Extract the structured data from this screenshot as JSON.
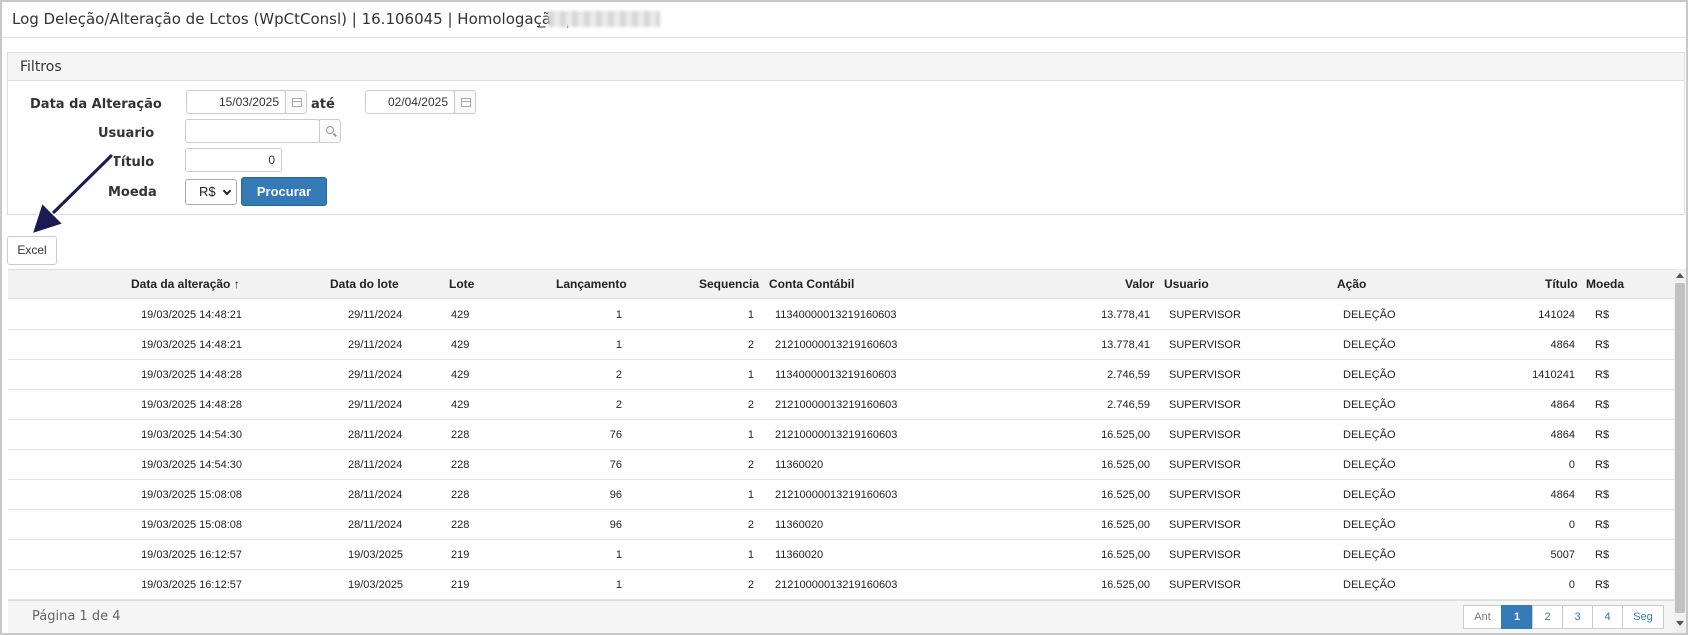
{
  "window": {
    "title": "Log Deleção/Alteração de Lctos (WpCtConsl) | 16.106045 | Homologação | S",
    "redacted_suffix": "_"
  },
  "filters": {
    "panel_title": "Filtros",
    "date_label": "Data da Alteração",
    "date_from": "15/03/2025",
    "date_connector": "até",
    "date_to": "02/04/2025",
    "user_label": "Usuario",
    "user_value": "",
    "titulo_label": "Título",
    "titulo_value": "0",
    "moeda_label": "Moeda",
    "moeda_value": "R$",
    "search_button": "Procurar"
  },
  "excel_button": "Excel",
  "table": {
    "columns": {
      "data_alteracao": "Data da alteração",
      "sort_indicator": "↑",
      "data_lote": "Data do lote",
      "lote": "Lote",
      "lancamento": "Lançamento",
      "sequencia": "Sequencia",
      "conta": "Conta Contábil",
      "valor": "Valor",
      "usuario": "Usuario",
      "acao": "Ação",
      "titulo": "Título",
      "moeda": "Moeda"
    },
    "rows": [
      {
        "data_alteracao": "19/03/2025 14:48:21",
        "data_lote": "29/11/2024",
        "lote": "429",
        "lancamento": "1",
        "sequencia": "1",
        "conta": "11340000013219160603",
        "valor": "13.778,41",
        "usuario": "SUPERVISOR",
        "acao": "DELEÇÃO",
        "titulo": "141024",
        "moeda": "R$"
      },
      {
        "data_alteracao": "19/03/2025 14:48:21",
        "data_lote": "29/11/2024",
        "lote": "429",
        "lancamento": "1",
        "sequencia": "2",
        "conta": "21210000013219160603",
        "valor": "13.778,41",
        "usuario": "SUPERVISOR",
        "acao": "DELEÇÃO",
        "titulo": "4864",
        "moeda": "R$"
      },
      {
        "data_alteracao": "19/03/2025 14:48:28",
        "data_lote": "29/11/2024",
        "lote": "429",
        "lancamento": "2",
        "sequencia": "1",
        "conta": "11340000013219160603",
        "valor": "2.746,59",
        "usuario": "SUPERVISOR",
        "acao": "DELEÇÃO",
        "titulo": "1410241",
        "moeda": "R$"
      },
      {
        "data_alteracao": "19/03/2025 14:48:28",
        "data_lote": "29/11/2024",
        "lote": "429",
        "lancamento": "2",
        "sequencia": "2",
        "conta": "21210000013219160603",
        "valor": "2.746,59",
        "usuario": "SUPERVISOR",
        "acao": "DELEÇÃO",
        "titulo": "4864",
        "moeda": "R$"
      },
      {
        "data_alteracao": "19/03/2025 14:54:30",
        "data_lote": "28/11/2024",
        "lote": "228",
        "lancamento": "76",
        "sequencia": "1",
        "conta": "21210000013219160603",
        "valor": "16.525,00",
        "usuario": "SUPERVISOR",
        "acao": "DELEÇÃO",
        "titulo": "4864",
        "moeda": "R$"
      },
      {
        "data_alteracao": "19/03/2025 14:54:30",
        "data_lote": "28/11/2024",
        "lote": "228",
        "lancamento": "76",
        "sequencia": "2",
        "conta": "11360020",
        "valor": "16.525,00",
        "usuario": "SUPERVISOR",
        "acao": "DELEÇÃO",
        "titulo": "0",
        "moeda": "R$"
      },
      {
        "data_alteracao": "19/03/2025 15:08:08",
        "data_lote": "28/11/2024",
        "lote": "228",
        "lancamento": "96",
        "sequencia": "1",
        "conta": "21210000013219160603",
        "valor": "16.525,00",
        "usuario": "SUPERVISOR",
        "acao": "DELEÇÃO",
        "titulo": "4864",
        "moeda": "R$"
      },
      {
        "data_alteracao": "19/03/2025 15:08:08",
        "data_lote": "28/11/2024",
        "lote": "228",
        "lancamento": "96",
        "sequencia": "2",
        "conta": "11360020",
        "valor": "16.525,00",
        "usuario": "SUPERVISOR",
        "acao": "DELEÇÃO",
        "titulo": "0",
        "moeda": "R$"
      },
      {
        "data_alteracao": "19/03/2025 16:12:57",
        "data_lote": "19/03/2025",
        "lote": "219",
        "lancamento": "1",
        "sequencia": "1",
        "conta": "11360020",
        "valor": "16.525,00",
        "usuario": "SUPERVISOR",
        "acao": "DELEÇÃO",
        "titulo": "5007",
        "moeda": "R$"
      },
      {
        "data_alteracao": "19/03/2025 16:12:57",
        "data_lote": "19/03/2025",
        "lote": "219",
        "lancamento": "1",
        "sequencia": "2",
        "conta": "21210000013219160603",
        "valor": "16.525,00",
        "usuario": "SUPERVISOR",
        "acao": "DELEÇÃO",
        "titulo": "0",
        "moeda": "R$"
      }
    ]
  },
  "pagination": {
    "page_info": "Página 1 de 4",
    "prev": "Ant",
    "pages": [
      "1",
      "2",
      "3",
      "4"
    ],
    "next": "Seg",
    "current": "1"
  },
  "icons": {
    "calendar": "calendar-icon",
    "search": "search-icon",
    "annotation": "arrow-annotation-icon"
  },
  "colors": {
    "primary_button": "#337ab7",
    "annotation_arrow": "#1a1a55"
  }
}
